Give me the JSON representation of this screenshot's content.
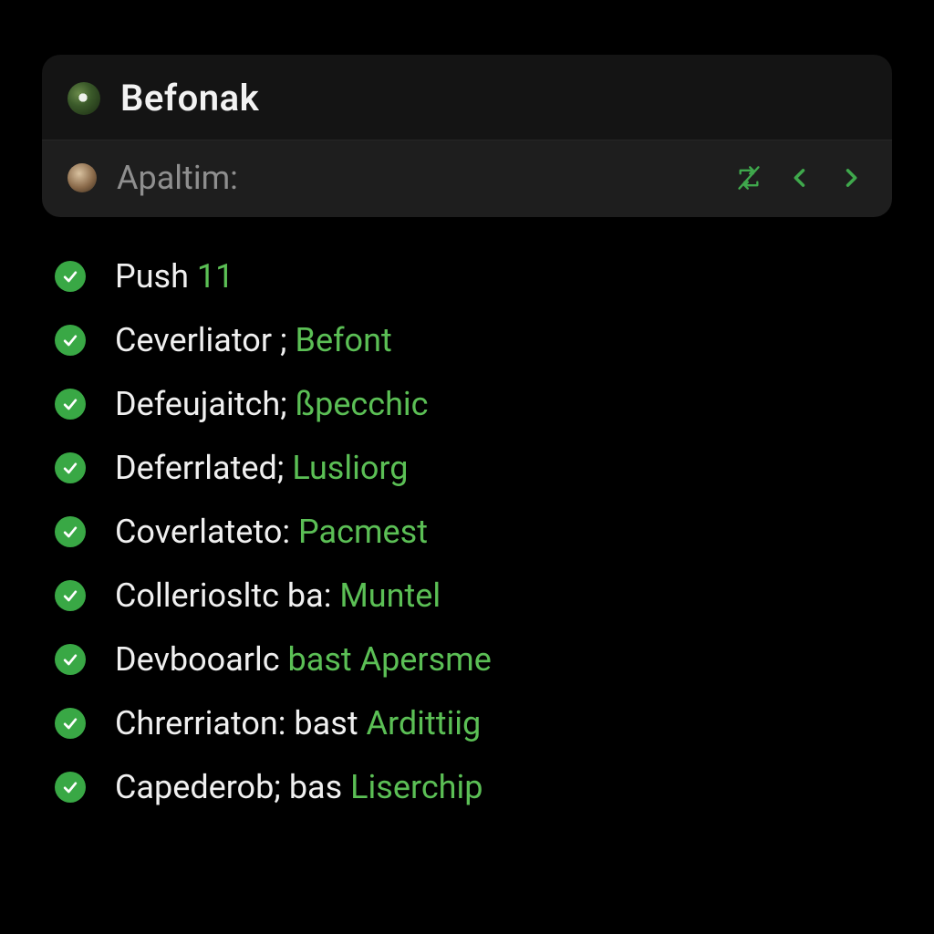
{
  "card": {
    "title": "Befonak",
    "sub_label": "Apaltim:"
  },
  "items": [
    {
      "prefix": "Push ",
      "hl": "11",
      "suffix": ""
    },
    {
      "prefix": "Ceverliator ; ",
      "hl": "Befont",
      "suffix": ""
    },
    {
      "prefix": "Defeujaitch; ",
      "hl": "ßpecchic",
      "suffix": ""
    },
    {
      "prefix": "Deferrlated; ",
      "hl": "Lusliorg",
      "suffix": ""
    },
    {
      "prefix": "Coverlateto: ",
      "hl": "Pacmest",
      "suffix": ""
    },
    {
      "prefix": "Colleriosltc ba: ",
      "hl": "Muntel",
      "suffix": ""
    },
    {
      "prefix": "Devbooarlc ",
      "hl": "bast Apersme",
      "suffix": ""
    },
    {
      "prefix": "Chrerriaton: bast ",
      "hl": "Ardittiig",
      "suffix": ""
    },
    {
      "prefix": "Capederob; bas ",
      "hl": "Liserchip",
      "suffix": ""
    }
  ],
  "colors": {
    "accent": "#5bbf55",
    "check": "#39a845"
  }
}
